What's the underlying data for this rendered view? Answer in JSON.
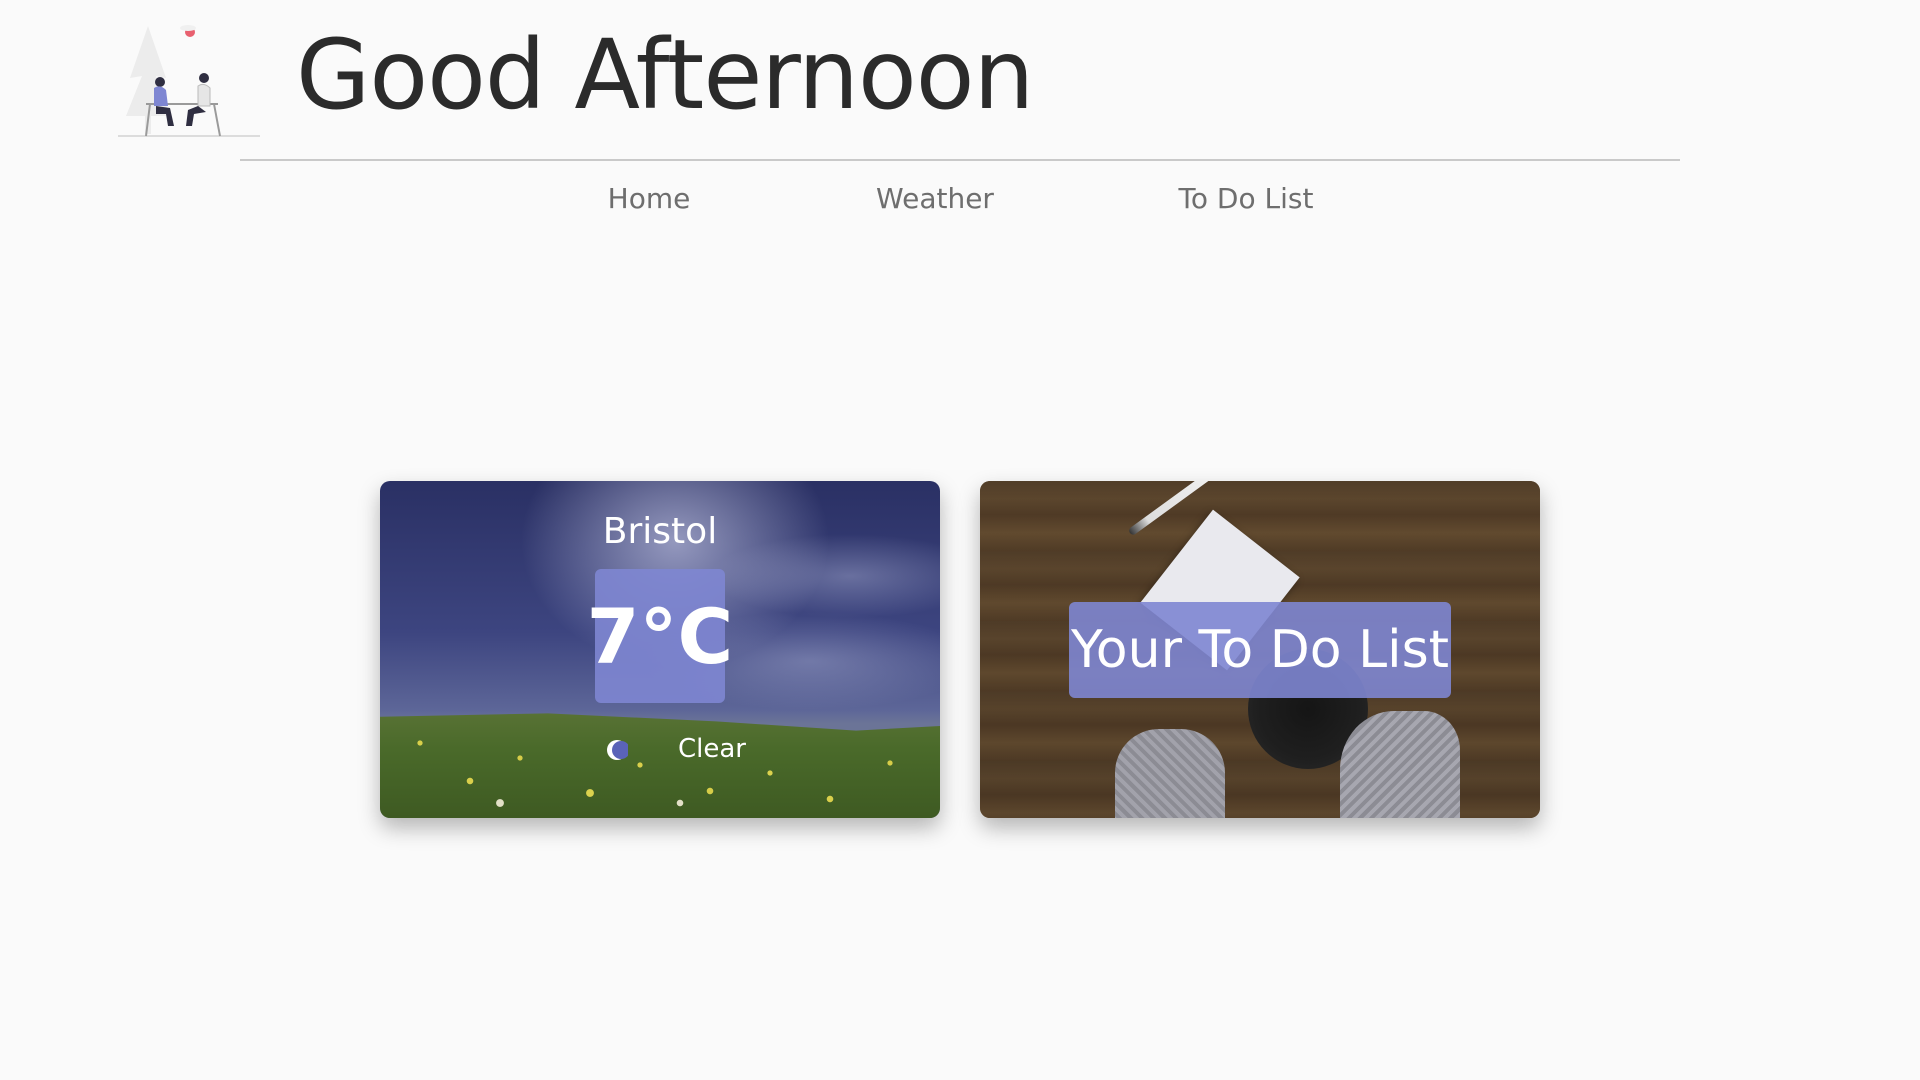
{
  "header": {
    "greeting": "Good Afternoon"
  },
  "nav": {
    "items": [
      {
        "label": "Home"
      },
      {
        "label": "Weather"
      },
      {
        "label": "To Do List"
      }
    ]
  },
  "weather_card": {
    "city": "Bristol",
    "temperature": "7°C",
    "condition": "Clear",
    "condition_icon": "moon-icon"
  },
  "todo_card": {
    "label": "Your To Do List"
  },
  "colors": {
    "background": "#fafafa",
    "accent": "#7e86d2",
    "text_dark": "#2b2b2b",
    "nav_text": "#6e6e6e"
  }
}
